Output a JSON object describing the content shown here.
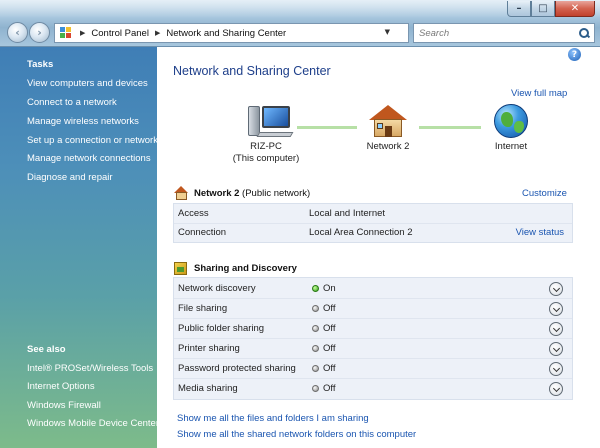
{
  "window": {
    "minimize_label": "–",
    "maximize_label": "□",
    "close_label": "✕"
  },
  "nav": {
    "back_label": "‹",
    "forward_label": "›"
  },
  "address_bar": {
    "crumbs": [
      "Control Panel",
      "Network and Sharing Center"
    ],
    "search_placeholder": "Search"
  },
  "tasks": {
    "heading": "Tasks",
    "links": [
      "View computers and devices",
      "Connect to a network",
      "Manage wireless networks",
      "Set up a connection or network",
      "Manage network connections",
      "Diagnose and repair"
    ]
  },
  "see_also": {
    "heading": "See also",
    "links": [
      "Intel® PROSet/Wireless Tools",
      "Internet Options",
      "Windows Firewall",
      "Windows Mobile Device Center"
    ]
  },
  "main": {
    "title": "Network and Sharing Center",
    "help_label": "?",
    "view_full_map": "View full map",
    "map": {
      "computer_name": "RIZ-PC",
      "computer_sub": "(This computer)",
      "network_name": "Network  2",
      "internet_label": "Internet"
    },
    "network": {
      "name": "Network  2",
      "type": "(Public network)",
      "customize": "Customize",
      "rows": [
        {
          "key": "Access",
          "value": "Local and Internet",
          "action": ""
        },
        {
          "key": "Connection",
          "value": "Local Area Connection 2",
          "action": "View status"
        }
      ]
    },
    "sharing": {
      "title": "Sharing and Discovery",
      "rows": [
        {
          "label": "Network discovery",
          "state": "On"
        },
        {
          "label": "File sharing",
          "state": "Off"
        },
        {
          "label": "Public folder sharing",
          "state": "Off"
        },
        {
          "label": "Printer sharing",
          "state": "Off"
        },
        {
          "label": "Password protected sharing",
          "state": "Off"
        },
        {
          "label": "Media sharing",
          "state": "Off"
        }
      ]
    },
    "bottom_links": [
      "Show me all the files and folders I am sharing",
      "Show me all the shared network folders on this computer"
    ]
  }
}
